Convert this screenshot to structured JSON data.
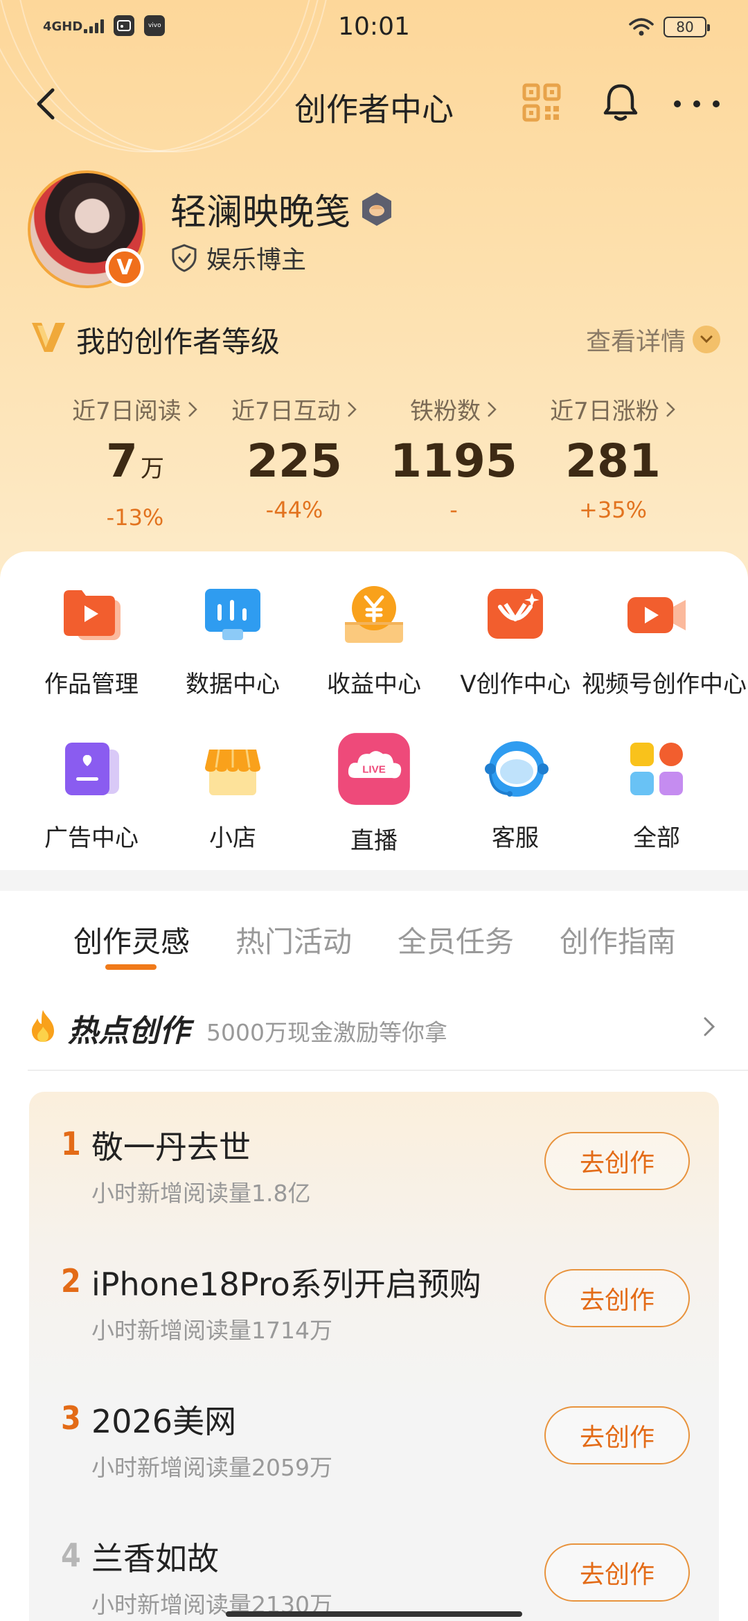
{
  "status_bar": {
    "time": "10:01",
    "network": "4GHD",
    "app_icon_label": "vivo",
    "battery": "80"
  },
  "nav": {
    "title": "创作者中心"
  },
  "profile": {
    "username": "轻澜映晚笺",
    "role": "娱乐博主",
    "badge": "V"
  },
  "level": {
    "title": "我的创作者等级",
    "detail_link": "查看详情"
  },
  "stats": [
    {
      "label": "近7日阅读",
      "value": "7",
      "unit": "万",
      "change": "-13%"
    },
    {
      "label": "近7日互动",
      "value": "225",
      "unit": "",
      "change": "-44%"
    },
    {
      "label": "铁粉数",
      "value": "1195",
      "unit": "",
      "change": "-"
    },
    {
      "label": "近7日涨粉",
      "value": "281",
      "unit": "",
      "change": "+35%"
    }
  ],
  "grid": [
    {
      "label": "作品管理",
      "icon": "works-icon"
    },
    {
      "label": "数据中心",
      "icon": "data-icon"
    },
    {
      "label": "收益中心",
      "icon": "income-icon"
    },
    {
      "label": "V创作中心",
      "icon": "v-create-icon"
    },
    {
      "label": "视频号创作中心",
      "icon": "video-icon"
    },
    {
      "label": "广告中心",
      "icon": "ad-icon"
    },
    {
      "label": "小店",
      "icon": "shop-icon"
    },
    {
      "label": "直播",
      "icon": "live-icon",
      "icon_text": "LIVE"
    },
    {
      "label": "客服",
      "icon": "service-icon"
    },
    {
      "label": "全部",
      "icon": "all-icon"
    }
  ],
  "tabs": [
    {
      "label": "创作灵感",
      "active": true
    },
    {
      "label": "热门活动",
      "active": false
    },
    {
      "label": "全员任务",
      "active": false
    },
    {
      "label": "创作指南",
      "active": false
    }
  ],
  "hot": {
    "title": "热点创作",
    "subtitle": "5000万现金激励等你拿"
  },
  "topics": [
    {
      "rank": "1",
      "title": "敬一丹去世",
      "sub": "小时新增阅读量1.8亿",
      "button": "去创作"
    },
    {
      "rank": "2",
      "title": "iPhone18Pro系列开启预购",
      "sub": "小时新增阅读量1714万",
      "button": "去创作"
    },
    {
      "rank": "3",
      "title": "2026美网",
      "sub": "小时新增阅读量2059万",
      "button": "去创作"
    },
    {
      "rank": "4",
      "title": "兰香如故",
      "sub": "小时新增阅读量2130万",
      "button": "去创作"
    }
  ],
  "colors": {
    "accent": "#f07a1a",
    "header_bg": "#fdd79a",
    "rank_color": "#e36b17"
  }
}
